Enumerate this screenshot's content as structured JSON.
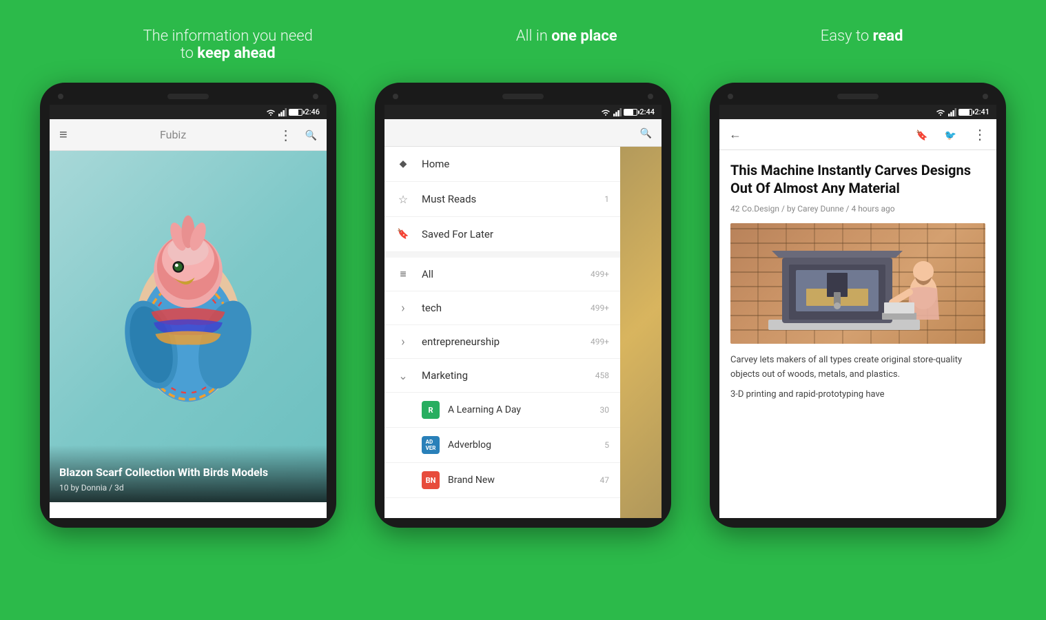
{
  "taglines": [
    {
      "text_before": "The information you need",
      "text_line2_before": "to ",
      "text_bold": "keep ahead",
      "id": "tagline1"
    },
    {
      "text_before": "All in ",
      "text_bold": "one place",
      "id": "tagline2"
    },
    {
      "text_before": "Easy to ",
      "text_bold": "read",
      "id": "tagline3"
    }
  ],
  "phone1": {
    "status_time": "2:46",
    "app_bar_title": "Fubiz",
    "article": {
      "title": "Blazon Scarf Collection With Birds Models",
      "meta": "10 by Donnia / 3d"
    }
  },
  "phone2": {
    "status_time": "2:44",
    "nav_items_top": [
      {
        "icon": "home",
        "label": "Home",
        "badge": ""
      },
      {
        "icon": "star",
        "label": "Must Reads",
        "badge": "1"
      },
      {
        "icon": "bookmark",
        "label": "Saved For Later",
        "badge": ""
      }
    ],
    "nav_items_main": [
      {
        "icon": "list",
        "label": "All",
        "badge": "499+",
        "type": "normal"
      },
      {
        "icon": "chevron",
        "label": "tech",
        "badge": "499+",
        "type": "collapsible"
      },
      {
        "icon": "chevron",
        "label": "entrepreneurship",
        "badge": "499+",
        "type": "collapsible"
      },
      {
        "icon": "chevron-down",
        "label": "Marketing",
        "badge": "458",
        "type": "expanded"
      }
    ],
    "nav_items_sub": [
      {
        "color": "r",
        "label": "A Learning A Day",
        "badge": "30",
        "letter": "R"
      },
      {
        "color": "adv",
        "label": "Adverblog",
        "badge": "5",
        "letter": "AD VER"
      },
      {
        "color": "bn",
        "label": "Brand New",
        "badge": "47",
        "letter": "BN"
      }
    ]
  },
  "phone3": {
    "status_time": "2:41",
    "article": {
      "title": "This Machine Instantly Carves Designs Out Of Almost Any Material",
      "byline": "42 Co.Design / by Carey Dunne / 4 hours ago",
      "body1": "Carvey lets makers of all types create original store-quality objects out of woods, metals, and plastics.",
      "body2": "3-D printing and rapid-prototyping have"
    }
  }
}
